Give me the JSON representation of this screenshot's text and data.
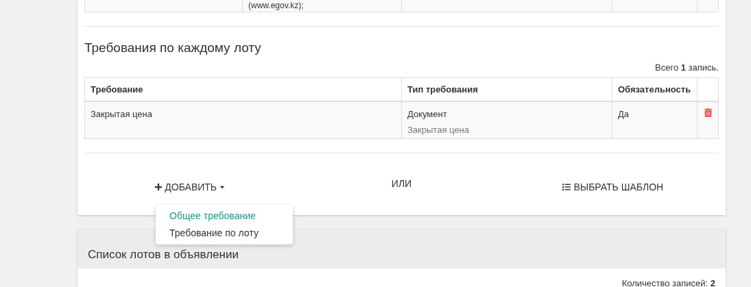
{
  "top_table": {
    "row": {
      "column_2": "(www.egov.kz);"
    }
  },
  "section": {
    "title": "Требования по каждому лоту",
    "count": {
      "prefix": "Всего ",
      "number": "1",
      "suffix": " запись."
    },
    "table": {
      "columns": [
        "Требование",
        "Тип требования",
        "Обязательность"
      ],
      "rows": [
        {
          "requirement": "Закрытая цена",
          "type": "Документ",
          "type_detail": "Закрытая цена",
          "mandatory": "Да"
        }
      ]
    },
    "add_button": "ДОБАВИТЬ",
    "or_label": "ИЛИ",
    "template_button": "ВЫБРАТЬ ШАБЛОН",
    "menu": [
      {
        "label": "Общее требование",
        "selected": true
      },
      {
        "label": "Требование по лоту",
        "selected": false
      }
    ]
  },
  "lots_panel": {
    "title": "Список лотов в объявлении",
    "count": {
      "prefix": "Количество записей: ",
      "number": "2"
    }
  }
}
